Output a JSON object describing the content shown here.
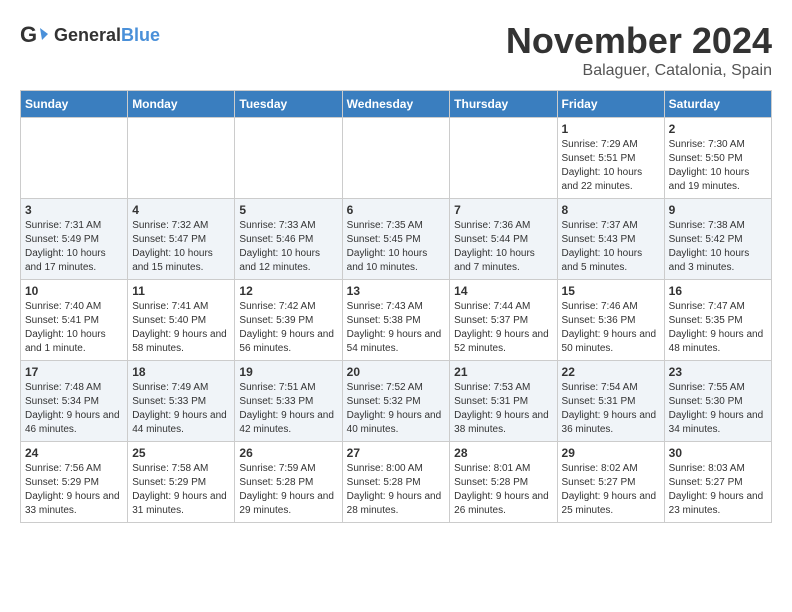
{
  "logo": {
    "general": "General",
    "blue": "Blue"
  },
  "title": "November 2024",
  "location": "Balaguer, Catalonia, Spain",
  "days_header": [
    "Sunday",
    "Monday",
    "Tuesday",
    "Wednesday",
    "Thursday",
    "Friday",
    "Saturday"
  ],
  "weeks": [
    [
      {
        "day": "",
        "info": ""
      },
      {
        "day": "",
        "info": ""
      },
      {
        "day": "",
        "info": ""
      },
      {
        "day": "",
        "info": ""
      },
      {
        "day": "",
        "info": ""
      },
      {
        "day": "1",
        "info": "Sunrise: 7:29 AM\nSunset: 5:51 PM\nDaylight: 10 hours and 22 minutes."
      },
      {
        "day": "2",
        "info": "Sunrise: 7:30 AM\nSunset: 5:50 PM\nDaylight: 10 hours and 19 minutes."
      }
    ],
    [
      {
        "day": "3",
        "info": "Sunrise: 7:31 AM\nSunset: 5:49 PM\nDaylight: 10 hours and 17 minutes."
      },
      {
        "day": "4",
        "info": "Sunrise: 7:32 AM\nSunset: 5:47 PM\nDaylight: 10 hours and 15 minutes."
      },
      {
        "day": "5",
        "info": "Sunrise: 7:33 AM\nSunset: 5:46 PM\nDaylight: 10 hours and 12 minutes."
      },
      {
        "day": "6",
        "info": "Sunrise: 7:35 AM\nSunset: 5:45 PM\nDaylight: 10 hours and 10 minutes."
      },
      {
        "day": "7",
        "info": "Sunrise: 7:36 AM\nSunset: 5:44 PM\nDaylight: 10 hours and 7 minutes."
      },
      {
        "day": "8",
        "info": "Sunrise: 7:37 AM\nSunset: 5:43 PM\nDaylight: 10 hours and 5 minutes."
      },
      {
        "day": "9",
        "info": "Sunrise: 7:38 AM\nSunset: 5:42 PM\nDaylight: 10 hours and 3 minutes."
      }
    ],
    [
      {
        "day": "10",
        "info": "Sunrise: 7:40 AM\nSunset: 5:41 PM\nDaylight: 10 hours and 1 minute."
      },
      {
        "day": "11",
        "info": "Sunrise: 7:41 AM\nSunset: 5:40 PM\nDaylight: 9 hours and 58 minutes."
      },
      {
        "day": "12",
        "info": "Sunrise: 7:42 AM\nSunset: 5:39 PM\nDaylight: 9 hours and 56 minutes."
      },
      {
        "day": "13",
        "info": "Sunrise: 7:43 AM\nSunset: 5:38 PM\nDaylight: 9 hours and 54 minutes."
      },
      {
        "day": "14",
        "info": "Sunrise: 7:44 AM\nSunset: 5:37 PM\nDaylight: 9 hours and 52 minutes."
      },
      {
        "day": "15",
        "info": "Sunrise: 7:46 AM\nSunset: 5:36 PM\nDaylight: 9 hours and 50 minutes."
      },
      {
        "day": "16",
        "info": "Sunrise: 7:47 AM\nSunset: 5:35 PM\nDaylight: 9 hours and 48 minutes."
      }
    ],
    [
      {
        "day": "17",
        "info": "Sunrise: 7:48 AM\nSunset: 5:34 PM\nDaylight: 9 hours and 46 minutes."
      },
      {
        "day": "18",
        "info": "Sunrise: 7:49 AM\nSunset: 5:33 PM\nDaylight: 9 hours and 44 minutes."
      },
      {
        "day": "19",
        "info": "Sunrise: 7:51 AM\nSunset: 5:33 PM\nDaylight: 9 hours and 42 minutes."
      },
      {
        "day": "20",
        "info": "Sunrise: 7:52 AM\nSunset: 5:32 PM\nDaylight: 9 hours and 40 minutes."
      },
      {
        "day": "21",
        "info": "Sunrise: 7:53 AM\nSunset: 5:31 PM\nDaylight: 9 hours and 38 minutes."
      },
      {
        "day": "22",
        "info": "Sunrise: 7:54 AM\nSunset: 5:31 PM\nDaylight: 9 hours and 36 minutes."
      },
      {
        "day": "23",
        "info": "Sunrise: 7:55 AM\nSunset: 5:30 PM\nDaylight: 9 hours and 34 minutes."
      }
    ],
    [
      {
        "day": "24",
        "info": "Sunrise: 7:56 AM\nSunset: 5:29 PM\nDaylight: 9 hours and 33 minutes."
      },
      {
        "day": "25",
        "info": "Sunrise: 7:58 AM\nSunset: 5:29 PM\nDaylight: 9 hours and 31 minutes."
      },
      {
        "day": "26",
        "info": "Sunrise: 7:59 AM\nSunset: 5:28 PM\nDaylight: 9 hours and 29 minutes."
      },
      {
        "day": "27",
        "info": "Sunrise: 8:00 AM\nSunset: 5:28 PM\nDaylight: 9 hours and 28 minutes."
      },
      {
        "day": "28",
        "info": "Sunrise: 8:01 AM\nSunset: 5:28 PM\nDaylight: 9 hours and 26 minutes."
      },
      {
        "day": "29",
        "info": "Sunrise: 8:02 AM\nSunset: 5:27 PM\nDaylight: 9 hours and 25 minutes."
      },
      {
        "day": "30",
        "info": "Sunrise: 8:03 AM\nSunset: 5:27 PM\nDaylight: 9 hours and 23 minutes."
      }
    ]
  ]
}
